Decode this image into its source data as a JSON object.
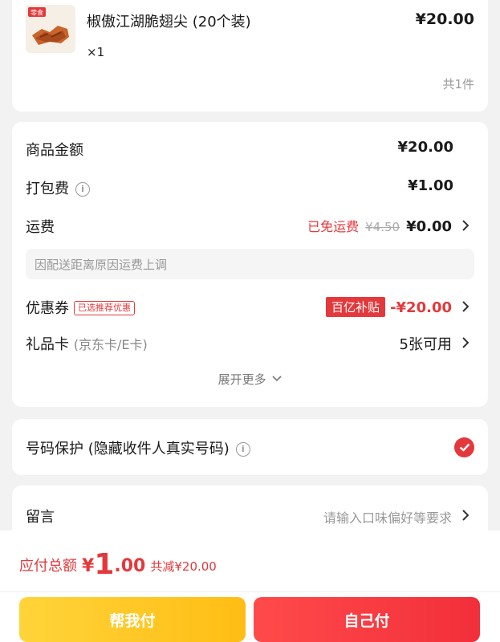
{
  "product": {
    "name": "椒傲江湖脆翅尖 (20个装)",
    "price": "¥20.00",
    "quantity": "×1",
    "total_count": "共1件",
    "thumb_text": "零食"
  },
  "fees": {
    "goods_amount": {
      "label": "商品金额",
      "value": "¥20.00"
    },
    "packing_fee": {
      "label": "打包费",
      "value": "¥1.00"
    },
    "shipping": {
      "label": "运费",
      "free_tag": "已免运费",
      "original": "¥4.50",
      "value": "¥0.00",
      "note": "因配送距离原因运费上调"
    },
    "coupon": {
      "label": "优惠券",
      "badge": "已选推荐优惠",
      "subsidy": "百亿补贴",
      "value": "-¥20.00"
    },
    "gift_card": {
      "label": "礼品卡",
      "sub_label": "(京东卡/E卡)",
      "value": "5张可用"
    },
    "expand_label": "展开更多"
  },
  "privacy": {
    "label": "号码保护 (隐藏收件人真实号码)",
    "checked": true
  },
  "message": {
    "label": "留言",
    "placeholder": "请输入口味偏好等要求"
  },
  "footer": {
    "total_label": "应付总额",
    "currency": "¥",
    "amount_int": "1",
    "amount_dec": ".00",
    "saved": "共减¥20.00",
    "friend_pay": "帮我付",
    "self_pay": "自己付"
  },
  "colors": {
    "accent_red": "#e4393c",
    "friend_yellow": "#ffc61e",
    "background": "#f2f2f2"
  }
}
